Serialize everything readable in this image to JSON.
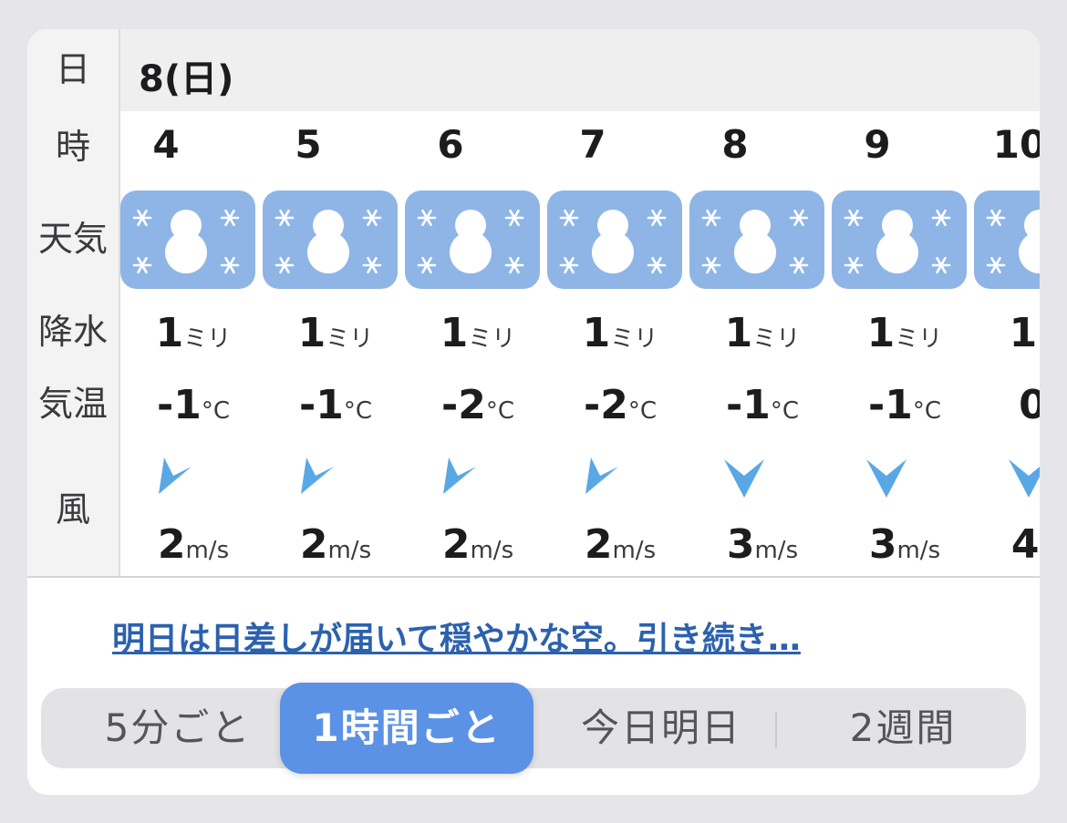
{
  "row_labels": {
    "date": "日",
    "hour": "時",
    "weather": "天気",
    "precip": "降水",
    "temp": "気温",
    "wind": "風"
  },
  "date": "8(日)",
  "hours": [
    {
      "hour": "4",
      "weather_icon": "snow-icon",
      "precip": "1",
      "temp": "-1",
      "wind_dir": "southwest",
      "wind": "2"
    },
    {
      "hour": "5",
      "weather_icon": "snow-icon",
      "precip": "1",
      "temp": "-1",
      "wind_dir": "southwest",
      "wind": "2"
    },
    {
      "hour": "6",
      "weather_icon": "snow-icon",
      "precip": "1",
      "temp": "-2",
      "wind_dir": "southwest",
      "wind": "2"
    },
    {
      "hour": "7",
      "weather_icon": "snow-icon",
      "precip": "1",
      "temp": "-2",
      "wind_dir": "southwest",
      "wind": "2"
    },
    {
      "hour": "8",
      "weather_icon": "snow-icon",
      "precip": "1",
      "temp": "-1",
      "wind_dir": "north",
      "wind": "3"
    },
    {
      "hour": "9",
      "weather_icon": "snow-icon",
      "precip": "1",
      "temp": "-1",
      "wind_dir": "north",
      "wind": "3"
    },
    {
      "hour": "10",
      "weather_icon": "snow-icon",
      "precip": "1",
      "temp": "0",
      "wind_dir": "north",
      "wind": "4"
    }
  ],
  "units": {
    "precip": "ミリ",
    "temp": "°C",
    "wind": "m/s"
  },
  "link_text": "明日は日差しが届いて穏やかな空。引き続き…",
  "tabs": [
    {
      "label": "5分ごと",
      "active": false
    },
    {
      "label": "1時間ごと",
      "active": true
    },
    {
      "label": "今日明日",
      "active": false
    },
    {
      "label": "2週間",
      "active": false
    }
  ],
  "colors": {
    "weather_bg": "#8fb5e6",
    "wind_arrow": "#5aa7e6",
    "link": "#2c61ad",
    "active_tab": "#5b92e5"
  }
}
